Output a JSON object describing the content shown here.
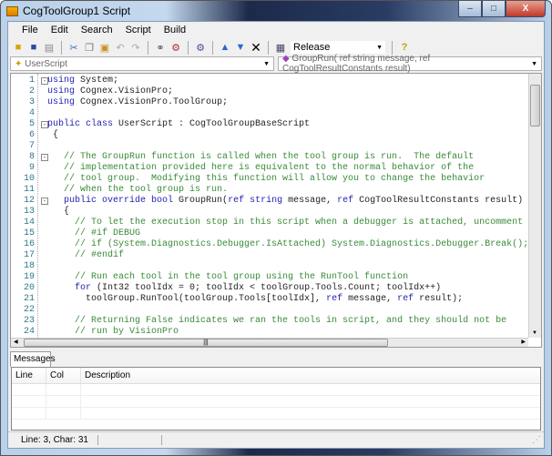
{
  "window": {
    "title": "CogToolGroup1 Script",
    "min": "–",
    "max": "□",
    "close": "X"
  },
  "menu": [
    "File",
    "Edit",
    "Search",
    "Script",
    "Build"
  ],
  "toolbar": {
    "icons": [
      "open-icon",
      "save-icon",
      "print-icon",
      "cut-icon",
      "copy-icon",
      "paste-icon",
      "undo-icon",
      "redo-icon",
      "find-icon",
      "build-icon",
      "references-icon",
      "move-up-icon",
      "move-down-icon",
      "delete-icon",
      "config-icon"
    ],
    "config": "Release",
    "help": "?"
  },
  "combos": {
    "class": "UserScript",
    "method": "GroupRun( ref string message,  ref CogToolResultConstants result)"
  },
  "code": [
    [
      [
        "k",
        "using"
      ],
      [
        "t",
        " System;"
      ]
    ],
    [
      [
        "k",
        "using"
      ],
      [
        "t",
        " Cognex.VisionPro;"
      ]
    ],
    [
      [
        "k",
        "using"
      ],
      [
        "t",
        " Cognex.VisionPro.ToolGroup;"
      ]
    ],
    [],
    [
      [
        "k",
        "public class"
      ],
      [
        "t",
        " UserScript : CogToolGroupBaseScript"
      ]
    ],
    [
      [
        "t",
        " {"
      ]
    ],
    [],
    [
      [
        "c",
        "   // The GroupRun function is called when the tool group is run.  The default"
      ]
    ],
    [
      [
        "c",
        "   // implementation provided here is equivalent to the normal behavior of the"
      ]
    ],
    [
      [
        "c",
        "   // tool group.  Modifying this function will allow you to change the behavior"
      ]
    ],
    [
      [
        "c",
        "   // when the tool group is run."
      ]
    ],
    [
      [
        "t",
        "   "
      ],
      [
        "k",
        "public override bool"
      ],
      [
        "t",
        " GroupRun("
      ],
      [
        "k",
        "ref string"
      ],
      [
        "t",
        " message, "
      ],
      [
        "k",
        "ref"
      ],
      [
        "t",
        " CogToolResultConstants result)"
      ]
    ],
    [
      [
        "t",
        "   {"
      ]
    ],
    [
      [
        "c",
        "     // To let the execution stop in this script when a debugger is attached, uncomment the"
      ]
    ],
    [
      [
        "c",
        "     // #if DEBUG"
      ]
    ],
    [
      [
        "c",
        "     // if (System.Diagnostics.Debugger.IsAttached) System.Diagnostics.Debugger.Break();"
      ]
    ],
    [
      [
        "c",
        "     // #endif"
      ]
    ],
    [],
    [
      [
        "c",
        "     // Run each tool in the tool group using the RunTool function"
      ]
    ],
    [
      [
        "t",
        "     "
      ],
      [
        "k",
        "for"
      ],
      [
        "t",
        " (Int32 toolIdx = 0; toolIdx < toolGroup.Tools.Count; toolIdx++)"
      ]
    ],
    [
      [
        "t",
        "       toolGroup.RunTool(toolGroup.Tools[toolIdx], "
      ],
      [
        "k",
        "ref"
      ],
      [
        "t",
        " message, "
      ],
      [
        "k",
        "ref"
      ],
      [
        "t",
        " result);"
      ]
    ],
    [],
    [
      [
        "c",
        "     // Returning False indicates we ran the tools in script, and they should not be"
      ]
    ],
    [
      [
        "c",
        "     // run by VisionPro"
      ]
    ]
  ],
  "folds": [
    1,
    5,
    8,
    12
  ],
  "messages": {
    "tab": "Messages",
    "columns": [
      "Line",
      "Col",
      "Description"
    ]
  },
  "status": {
    "position": "Line: 3, Char: 31"
  }
}
